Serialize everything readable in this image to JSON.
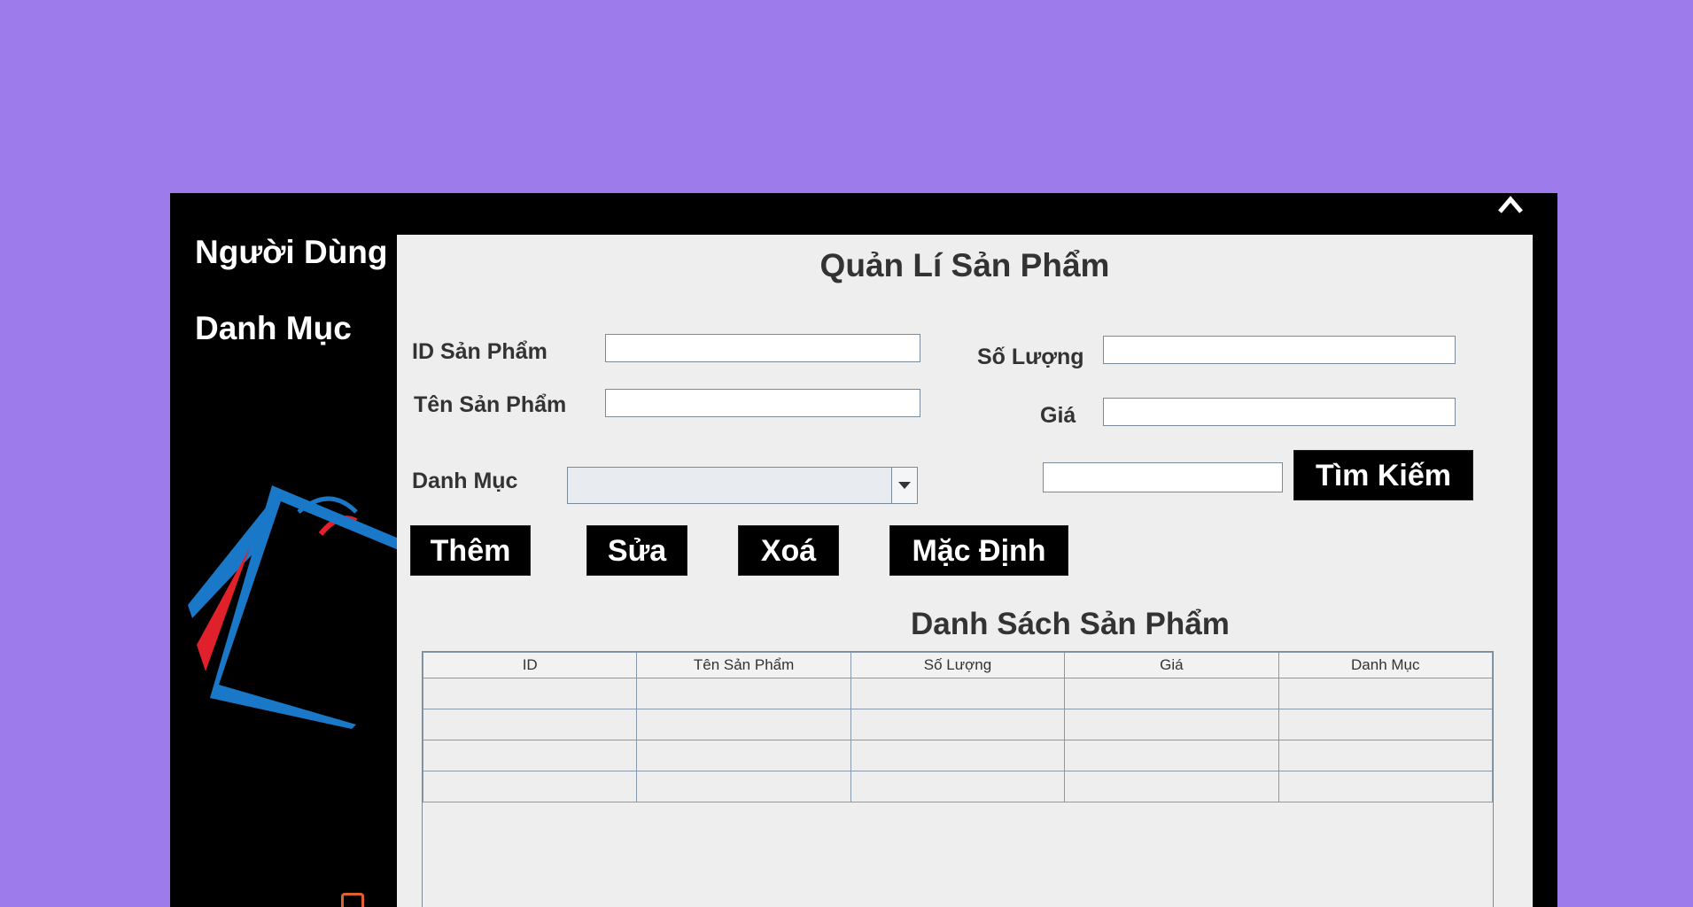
{
  "window": {
    "close_glyph": "^"
  },
  "sidebar": {
    "items": [
      {
        "label": "Người Dùng"
      },
      {
        "label": "Danh Mục"
      }
    ]
  },
  "panel": {
    "title": "Quản Lí Sản Phẩm",
    "fields": {
      "id_label": "ID Sản Phẩm",
      "id_value": "",
      "name_label": "Tên Sản Phẩm",
      "name_value": "",
      "qty_label": "Số Lượng",
      "qty_value": "",
      "price_label": "Giá",
      "price_value": "",
      "category_label": "Danh Mục",
      "category_value": "",
      "search_value": ""
    },
    "buttons": {
      "search": "Tìm Kiếm",
      "add": "Thêm",
      "edit": "Sửa",
      "delete": "Xoá",
      "default": "Mặc Định"
    },
    "list_title": "Danh Sách Sản Phẩm",
    "table": {
      "columns": [
        "ID",
        "Tên Sản Phẩm",
        "Số Lượng",
        "Giá",
        "Danh Mục"
      ],
      "rows": [
        [
          "",
          "",
          "",
          "",
          ""
        ],
        [
          "",
          "",
          "",
          "",
          ""
        ],
        [
          "",
          "",
          "",
          "",
          ""
        ],
        [
          "",
          "",
          "",
          "",
          ""
        ]
      ]
    }
  },
  "colors": {
    "background": "#9d7bea",
    "window": "#000000",
    "panel": "#eeeeee",
    "button": "#000000",
    "logo_blue": "#1a78c8",
    "logo_red": "#e0202a"
  }
}
